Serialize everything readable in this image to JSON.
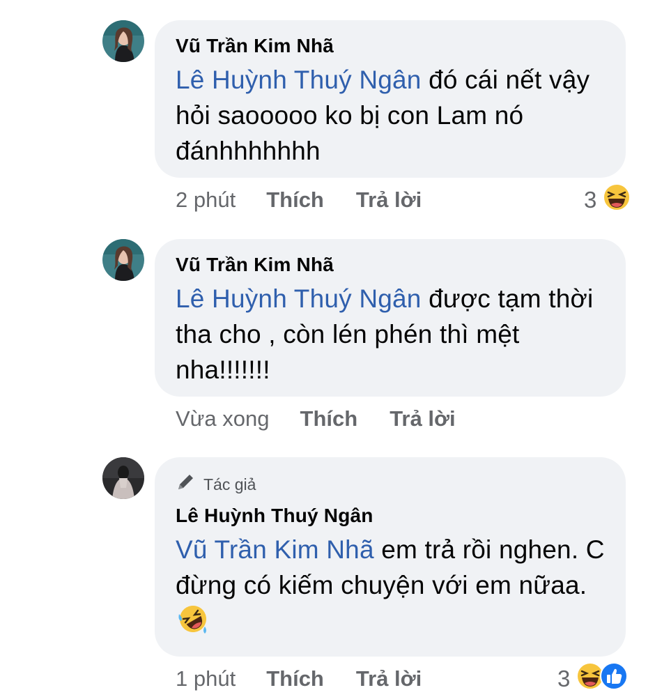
{
  "comments": [
    {
      "author": "Vũ Trần Kim Nhã",
      "mention": "Lê Huỳnh Thuý Ngân",
      "text": " đó cái nết vậy hỏi saooooo ko bị con Lam nó đánhhhhhhh",
      "time": "2 phút",
      "like_label": "Thích",
      "reply_label": "Trả lời",
      "reaction_count": "3",
      "reactions": [
        "laugh-emoji"
      ]
    },
    {
      "author": "Vũ Trần Kim Nhã",
      "mention": "Lê Huỳnh Thuý Ngân",
      "text": " được tạm thời tha cho , còn lén phén thì mệt nha!!!!!!!",
      "time": "Vừa xong",
      "like_label": "Thích",
      "reply_label": "Trả lời"
    },
    {
      "badge": "Tác giả",
      "author": "Lê Huỳnh Thuý Ngân",
      "mention": "Vũ Trần Kim Nhã",
      "text": " em trả rồi nghen. C đừng có kiếm chuyện với em nữaa. ",
      "trailing_emoji": "rofl-emoji",
      "time": "1 phút",
      "like_label": "Thích",
      "reply_label": "Trả lời",
      "reaction_count": "3",
      "reactions": [
        "laugh-emoji",
        "like-emoji"
      ]
    }
  ],
  "colors": {
    "bubble": "#f0f2f5",
    "mention": "#2f5fad",
    "meta": "#65676b",
    "like_blue": "#1877f2",
    "emoji_yellow": "#f7c53d"
  }
}
